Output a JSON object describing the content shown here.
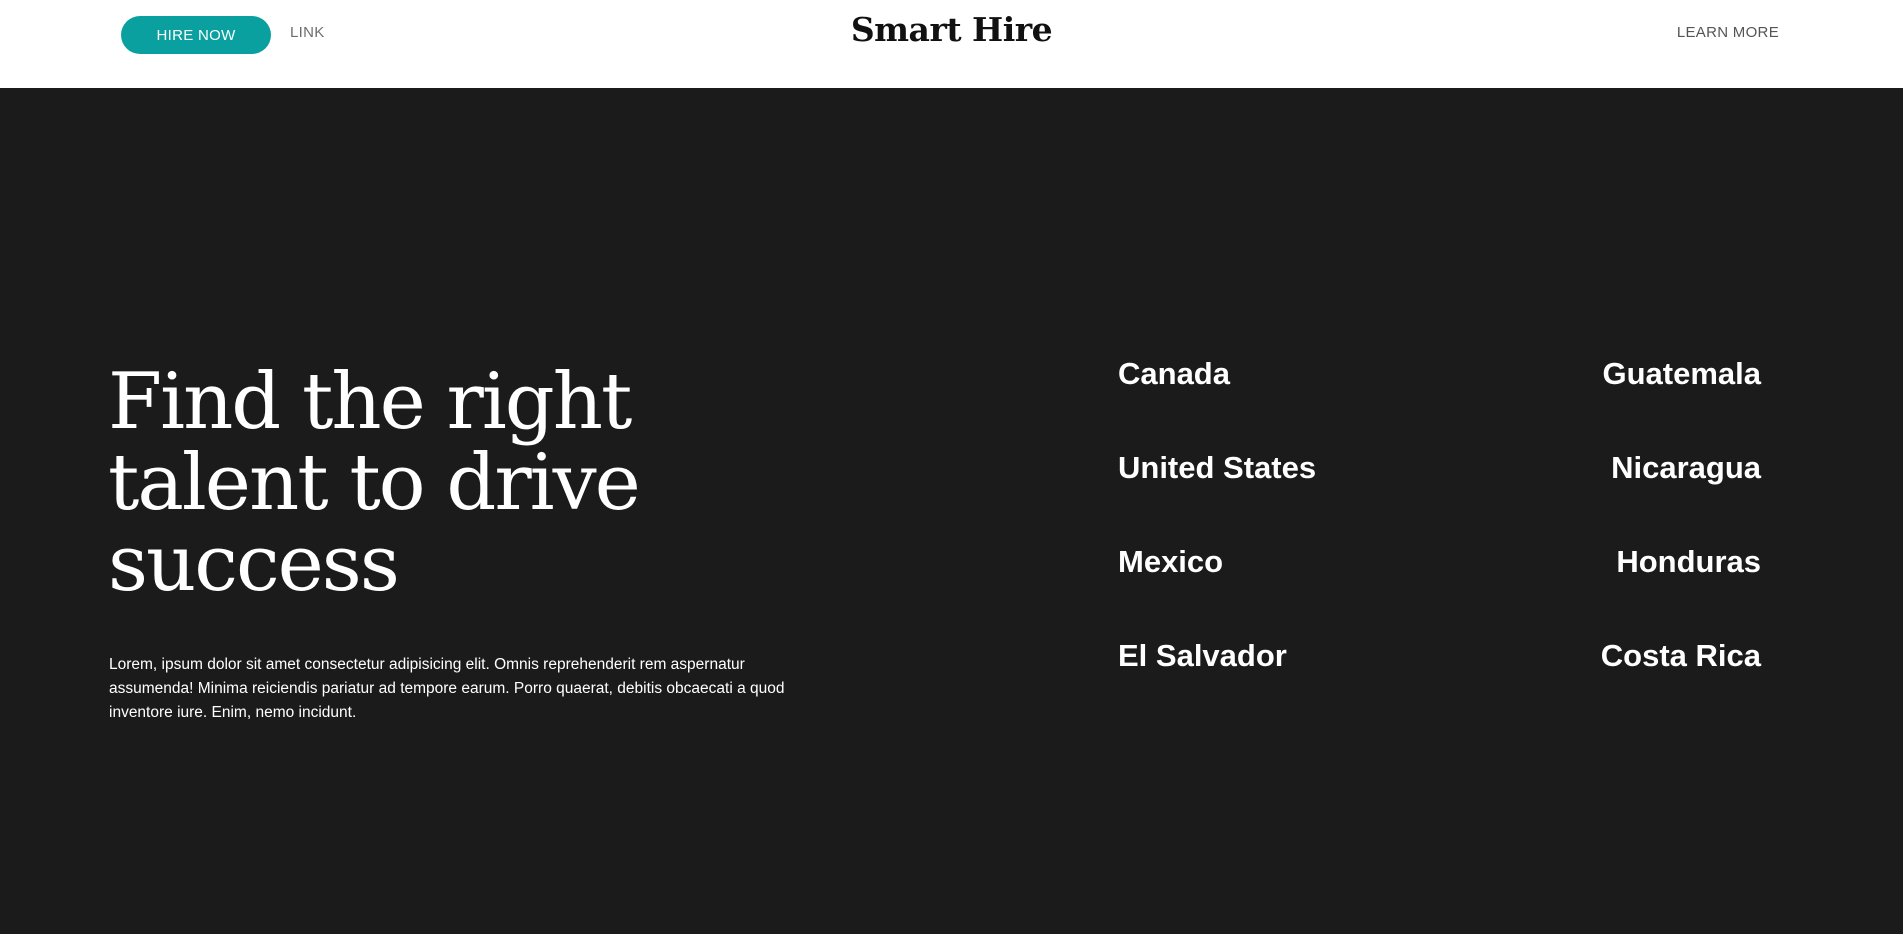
{
  "header": {
    "hire_button_label": "HIRE NOW",
    "link_label": "LINK",
    "logo_text": "Smart Hire",
    "learn_more_label": "LEARN MORE"
  },
  "hero": {
    "headline": "Find the right talent to drive success",
    "intro": "Lorem, ipsum dolor sit amet consectetur adipisicing elit. Omnis reprehenderit rem aspernatur assumenda! Minima reiciendis pariatur ad tempore earum. Porro quaerat, debitis obcaecati a quod inventore iure. Enim, nemo incidunt.",
    "countries_left": [
      "Canada",
      "United States",
      "Mexico",
      "El Salvador"
    ],
    "countries_right": [
      "Guatemala",
      "Nicaragua",
      "Honduras",
      "Costa Rica"
    ]
  },
  "colors": {
    "accent": "#0aa0a0",
    "dark_background": "#1b1b1b",
    "header_background": "#ffffff"
  }
}
